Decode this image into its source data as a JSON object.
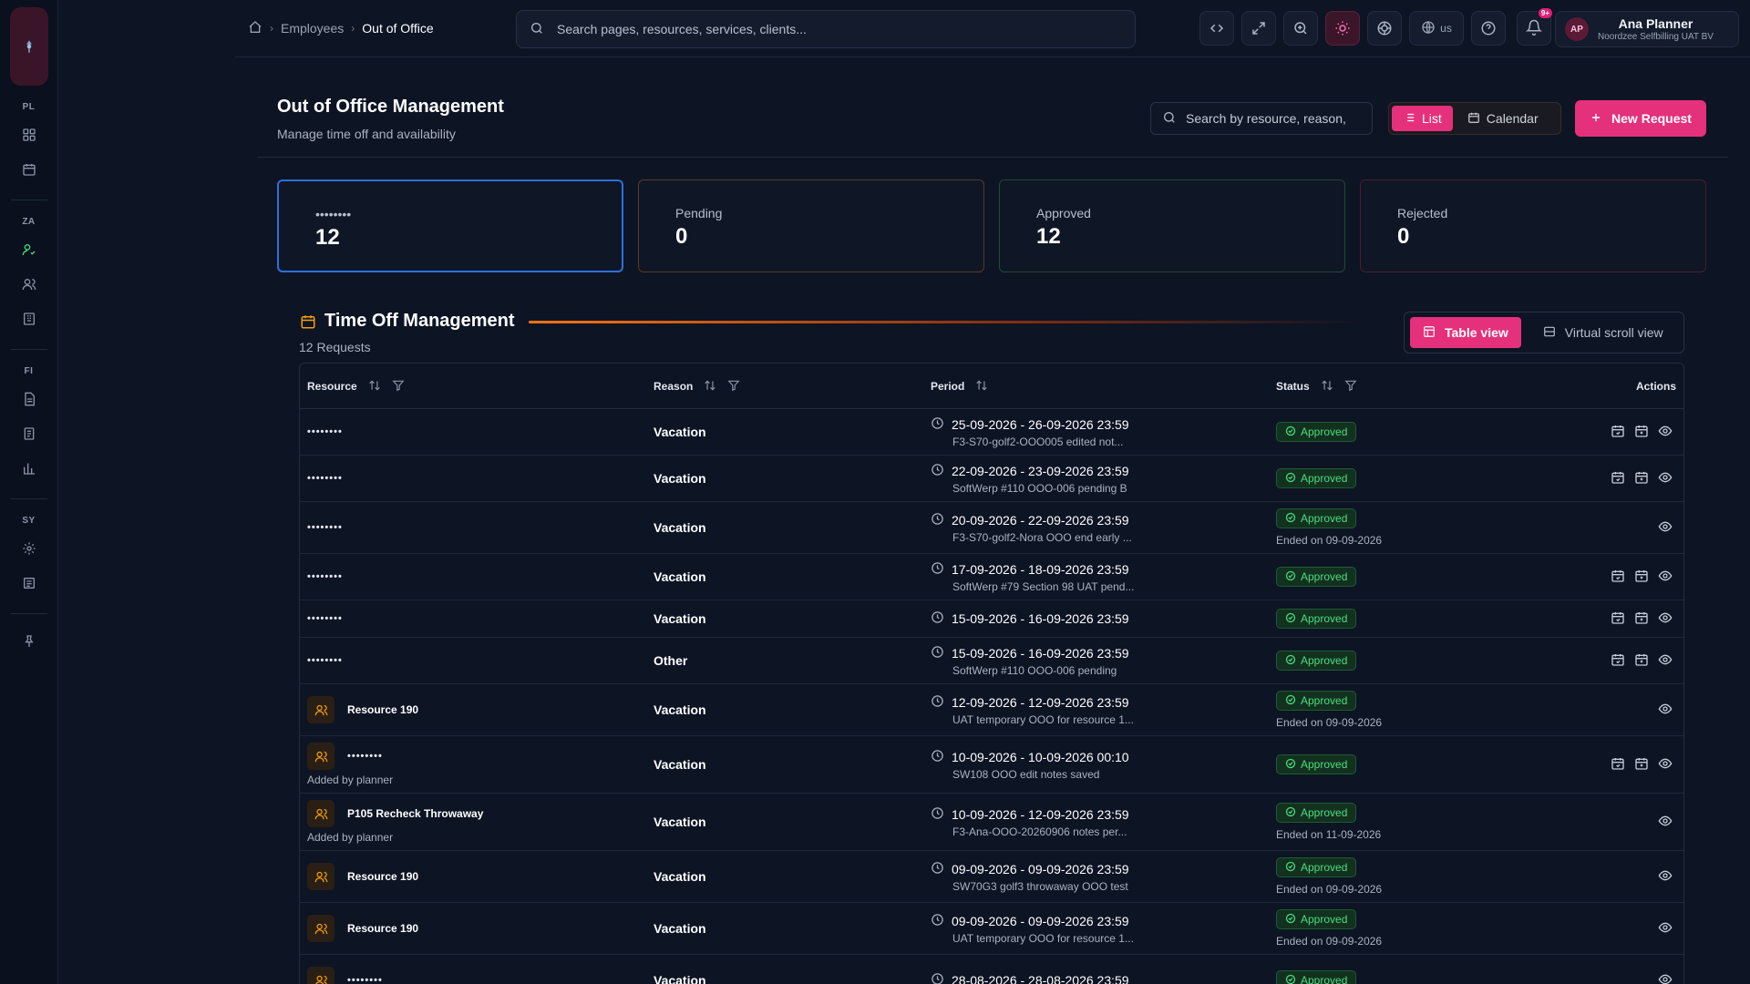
{
  "topbar": {
    "breadcrumb": {
      "level1": "Employees",
      "current": "Out of Office"
    },
    "search_placeholder": "Search pages, resources, services, clients...",
    "language": "us",
    "notifications_badge": "9+",
    "user": {
      "initials": "AP",
      "name": "Ana Planner",
      "org": "Noordzee Selfbilling UAT BV"
    }
  },
  "rail": {
    "sections": [
      "PL",
      "ZA",
      "FI",
      "SY"
    ]
  },
  "header": {
    "title": "Out of Office Management",
    "subtitle": "Manage time off and availability",
    "search_placeholder": "Search by resource, reason,",
    "view_list": "List",
    "view_calendar": "Calendar",
    "new_request": "New Request"
  },
  "stats": [
    {
      "label": "••••••••",
      "value": "12"
    },
    {
      "label": "Pending",
      "value": "0"
    },
    {
      "label": "Approved",
      "value": "12"
    },
    {
      "label": "Rejected",
      "value": "0"
    }
  ],
  "section": {
    "title": "Time Off Management",
    "count": "12 Requests",
    "table_view": "Table view",
    "virtual_view": "Virtual scroll view"
  },
  "table": {
    "columns": {
      "resource": "Resource",
      "reason": "Reason",
      "period": "Period",
      "status": "Status",
      "actions": "Actions"
    },
    "rows": [
      {
        "resource": "••••••••",
        "resource_sub": "",
        "reason": "Vacation",
        "period": "25-09-2026 - 26-09-2026 23:59",
        "note": "F3-S70-golf2-OOO005 edited not...",
        "status": "Approved",
        "ended": "",
        "edit": true
      },
      {
        "resource": "••••••••",
        "resource_sub": "",
        "reason": "Vacation",
        "period": "22-09-2026 - 23-09-2026 23:59",
        "note": "SoftWerp #110 OOO-006 pending B",
        "status": "Approved",
        "ended": "",
        "edit": true
      },
      {
        "resource": "••••••••",
        "resource_sub": "",
        "reason": "Vacation",
        "period": "20-09-2026 - 22-09-2026 23:59",
        "note": "F3-S70-golf2-Nora OOO end early ...",
        "status": "Approved",
        "ended": "Ended on 09-09-2026",
        "edit": false
      },
      {
        "resource": "••••••••",
        "resource_sub": "",
        "reason": "Vacation",
        "period": "17-09-2026 - 18-09-2026 23:59",
        "note": "SoftWerp #79 Section 98 UAT pend...",
        "status": "Approved",
        "ended": "",
        "edit": true
      },
      {
        "resource": "••••••••",
        "resource_sub": "",
        "reason": "Vacation",
        "period": "15-09-2026 - 16-09-2026 23:59",
        "note": "",
        "status": "Approved",
        "ended": "",
        "edit": true
      },
      {
        "resource": "••••••••",
        "resource_sub": "",
        "reason": "Other",
        "period": "15-09-2026 - 16-09-2026 23:59",
        "note": "SoftWerp #110 OOO-006 pending",
        "status": "Approved",
        "ended": "",
        "edit": true
      },
      {
        "resource": "Resource 190",
        "resource_sub": "",
        "reason": "Vacation",
        "period": "12-09-2026 - 12-09-2026 23:59",
        "note": "UAT temporary OOO for resource 1...",
        "status": "Approved",
        "ended": "Ended on 09-09-2026",
        "edit": false,
        "icon": true
      },
      {
        "resource": "••••••••",
        "resource_sub": "Added by planner",
        "reason": "Vacation",
        "period": "10-09-2026 - 10-09-2026 00:10",
        "note": "SW108 OOO edit notes saved",
        "status": "Approved",
        "ended": "",
        "edit": true,
        "icon": true
      },
      {
        "resource": "P105 Recheck Throwaway",
        "resource_sub": "Added by planner",
        "reason": "Vacation",
        "period": "10-09-2026 - 12-09-2026 23:59",
        "note": "F3-Ana-OOO-20260906 notes per...",
        "status": "Approved",
        "ended": "Ended on 11-09-2026",
        "edit": false,
        "icon": true
      },
      {
        "resource": "Resource 190",
        "resource_sub": "",
        "reason": "Vacation",
        "period": "09-09-2026 - 09-09-2026 23:59",
        "note": "SW70G3 golf3 throwaway OOO test",
        "status": "Approved",
        "ended": "Ended on 09-09-2026",
        "edit": false,
        "icon": true
      },
      {
        "resource": "Resource 190",
        "resource_sub": "",
        "reason": "Vacation",
        "period": "09-09-2026 - 09-09-2026 23:59",
        "note": "UAT temporary OOO for resource 1...",
        "status": "Approved",
        "ended": "Ended on 09-09-2026",
        "edit": false,
        "icon": true
      },
      {
        "resource": "••••••••",
        "resource_sub": "",
        "reason": "Vacation",
        "period": "28-08-2026 - 28-08-2026 23:59",
        "note": "",
        "status": "Approved",
        "ended": "",
        "edit": false,
        "icon": true
      }
    ]
  }
}
